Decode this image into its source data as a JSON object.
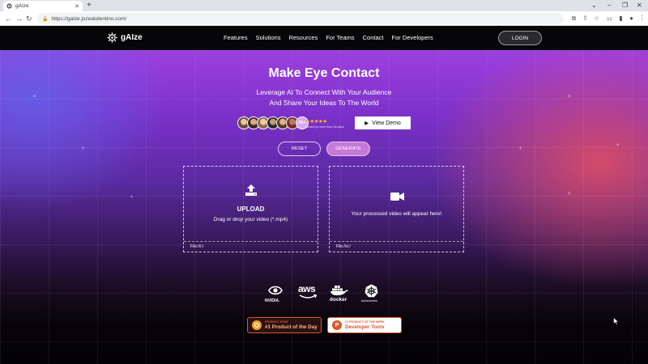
{
  "browser": {
    "tab_title": "gAIze",
    "new_tab": "+",
    "url": "https://gaize.jozeatolentino.com/",
    "controls": {
      "dropdown": "⌄",
      "minimize": "–",
      "restore": "❐",
      "close": "✕"
    }
  },
  "header": {
    "logo_text": "gAIze",
    "nav": [
      "Features",
      "Solutions",
      "Resources",
      "For Teams",
      "Contact",
      "For Developers"
    ],
    "login_label": "LOGIN"
  },
  "hero": {
    "title": "Make Eye Contact",
    "subtitle_line1": "Leverage AI To Connect With Your Audience",
    "subtitle_line2": "And Share Your Ideas To The World",
    "avatar_more": "2k+",
    "stars": "★★★★★",
    "loved_text": "Loved by more than 2k devs",
    "view_demo_label": "View Demo",
    "reset_label": "RESET",
    "generate_label": "GENERATE"
  },
  "upload_panel": {
    "title": "UPLOAD",
    "hint": "Drag or drop your video (*.mp4)",
    "file_label": "File://i:/"
  },
  "output_panel": {
    "text": "Your processed video will appear here!",
    "file_label": "File://o:/"
  },
  "partners": {
    "nvidia": "NVIDIA.",
    "aws": "aws",
    "docker": "docker",
    "kubernetes": "kubernetes"
  },
  "badges": {
    "product_hunt_small": "PRODUCT HUNT",
    "product_hunt_big": "#1 Product of the Day",
    "dev_tools_small": "#1 PRODUCT OF THE WEEK",
    "dev_tools_big": "Developer Tools",
    "dev_tools_letter": "P"
  },
  "colors": {
    "accent_purple": "#9d40e0",
    "accent_red": "#e8505c",
    "generate_button": "#c47ad8",
    "star": "#f5c518",
    "product_hunt": "#d9572d"
  }
}
